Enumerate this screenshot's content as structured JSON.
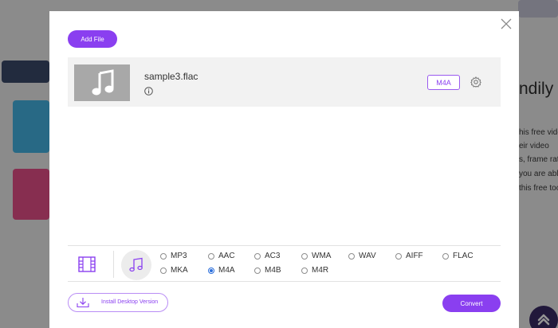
{
  "background": {
    "heading": "ndily",
    "lines": [
      "his free vide",
      "eir video",
      "s, frame rate",
      "you are able",
      "this free too"
    ]
  },
  "modal": {
    "add_file_label": "Add File",
    "file": {
      "name": "sample3.flac",
      "output_format": "M4A"
    },
    "formats": [
      {
        "label": "MP3",
        "selected": false
      },
      {
        "label": "AAC",
        "selected": false
      },
      {
        "label": "AC3",
        "selected": false
      },
      {
        "label": "WMA",
        "selected": false
      },
      {
        "label": "WAV",
        "selected": false
      },
      {
        "label": "AIFF",
        "selected": false
      },
      {
        "label": "FLAC",
        "selected": false
      },
      {
        "label": "MKA",
        "selected": false
      },
      {
        "label": "M4A",
        "selected": true
      },
      {
        "label": "M4B",
        "selected": false
      },
      {
        "label": "M4R",
        "selected": false
      }
    ],
    "install_label": "Install Desktop Version",
    "convert_label": "Convert"
  },
  "colors": {
    "accent": "#8a3ff0",
    "radio_selected": "#2a6edb"
  }
}
